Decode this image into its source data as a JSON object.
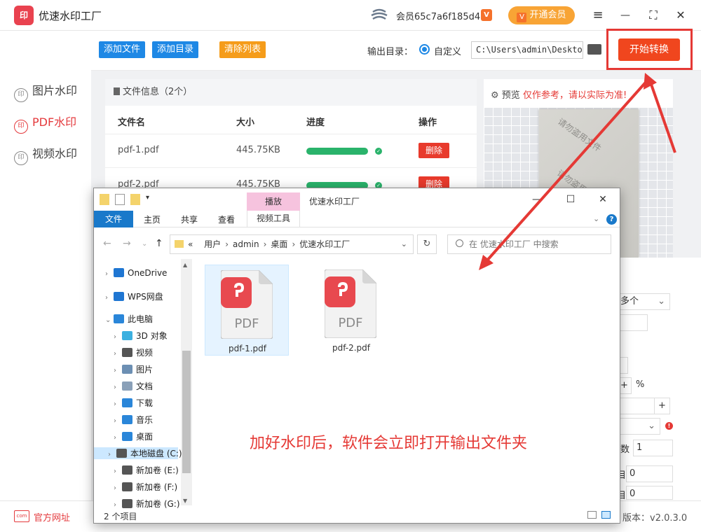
{
  "app": {
    "title": "优速水印工厂",
    "logo_text": "印",
    "user": "会员65c7a6f185d4",
    "vip_badge": "V",
    "vip_button": "开通会员"
  },
  "window_controls": [
    "≡",
    "—",
    "⛶",
    "✕"
  ],
  "sidebar": {
    "items": [
      {
        "icon": "印",
        "label": "图片水印",
        "active": false
      },
      {
        "icon": "印",
        "label": "PDF水印",
        "active": true
      },
      {
        "icon": "印",
        "label": "视频水印",
        "active": false
      }
    ],
    "site_icon": "com",
    "site_link": "官方网址"
  },
  "toolbar": {
    "add_file": "添加文件",
    "add_dir": "添加目录",
    "clear_list": "清除列表",
    "output_label": "输出目录：",
    "radio_label": "自定义",
    "output_path": "C:\\Users\\admin\\Desktop",
    "start_button": "开始转换"
  },
  "file_panel": {
    "header": "文件信息（2个）",
    "columns": [
      "文件名",
      "大小",
      "进度",
      "操作"
    ],
    "rows": [
      {
        "name": "pdf-1.pdf",
        "size": "445.75KB",
        "progress": 1.0,
        "action": "删除"
      },
      {
        "name": "pdf-2.pdf",
        "size": "445.75KB",
        "progress": 1.0,
        "action": "删除"
      }
    ]
  },
  "preview": {
    "label": "预览",
    "warning": "仅作参考，请以实际为准!",
    "watermark": [
      "请勿盗用文件",
      "请勿盗用文"
    ]
  },
  "settings_partial": {
    "select_value": "多个",
    "unit": "%",
    "plus": "+",
    "label_count": "数",
    "value_count": "1",
    "label_row1": "目",
    "value_row1": "0",
    "label_row2": "目",
    "value_row2": "0"
  },
  "version": "版本：v2.0.3.0",
  "explorer": {
    "play_tab": "播放",
    "window_title": "优速水印工厂",
    "controls": [
      "—",
      "☐",
      "✕"
    ],
    "ribbon": [
      "文件",
      "主页",
      "共享",
      "查看",
      "视频工具"
    ],
    "help": "?",
    "address": [
      "«",
      "用户",
      "admin",
      "桌面",
      "优速水印工厂"
    ],
    "search_placeholder": "在 优速水印工厂 中搜索",
    "tree": [
      {
        "label": "OneDrive",
        "icon": "cloud-icon",
        "color": "#1f76d2"
      },
      {
        "label": "WPS网盘",
        "icon": "cloud-icon",
        "color": "#1f76d2"
      },
      {
        "label": "此电脑",
        "icon": "computer-icon",
        "color": "#2a86d9"
      },
      {
        "label": "3D 对象",
        "icon": "cube-icon",
        "color": "#3cb0e0"
      },
      {
        "label": "视频",
        "icon": "film-icon",
        "color": "#555555"
      },
      {
        "label": "图片",
        "icon": "picture-icon",
        "color": "#6c8fb3"
      },
      {
        "label": "文档",
        "icon": "document-icon",
        "color": "#8aa0b8"
      },
      {
        "label": "下载",
        "icon": "download-icon",
        "color": "#2a86d9"
      },
      {
        "label": "音乐",
        "icon": "music-icon",
        "color": "#2a86d9"
      },
      {
        "label": "桌面",
        "icon": "desktop-icon",
        "color": "#2a86d9"
      },
      {
        "label": "本地磁盘 (C:)",
        "icon": "drive-icon",
        "color": "#555555"
      },
      {
        "label": "新加卷 (E:)",
        "icon": "drive-icon",
        "color": "#555555"
      },
      {
        "label": "新加卷 (F:)",
        "icon": "drive-icon",
        "color": "#555555"
      },
      {
        "label": "新加卷 (G:)",
        "icon": "drive-icon",
        "color": "#555555"
      }
    ],
    "files": [
      {
        "name": "pdf-1.pdf",
        "label": "PDF"
      },
      {
        "name": "pdf-2.pdf",
        "label": "PDF"
      }
    ],
    "status": "2 个项目"
  },
  "annotation": "加好水印后，软件会立即打开输出文件夹",
  "colors": {
    "accent_red": "#e4393c",
    "start_button": "#f0461e",
    "blue_button": "#1e88e5",
    "orange_button": "#f59c1a",
    "progress": "#2ab36b",
    "explorer_blue": "#1979ca"
  }
}
